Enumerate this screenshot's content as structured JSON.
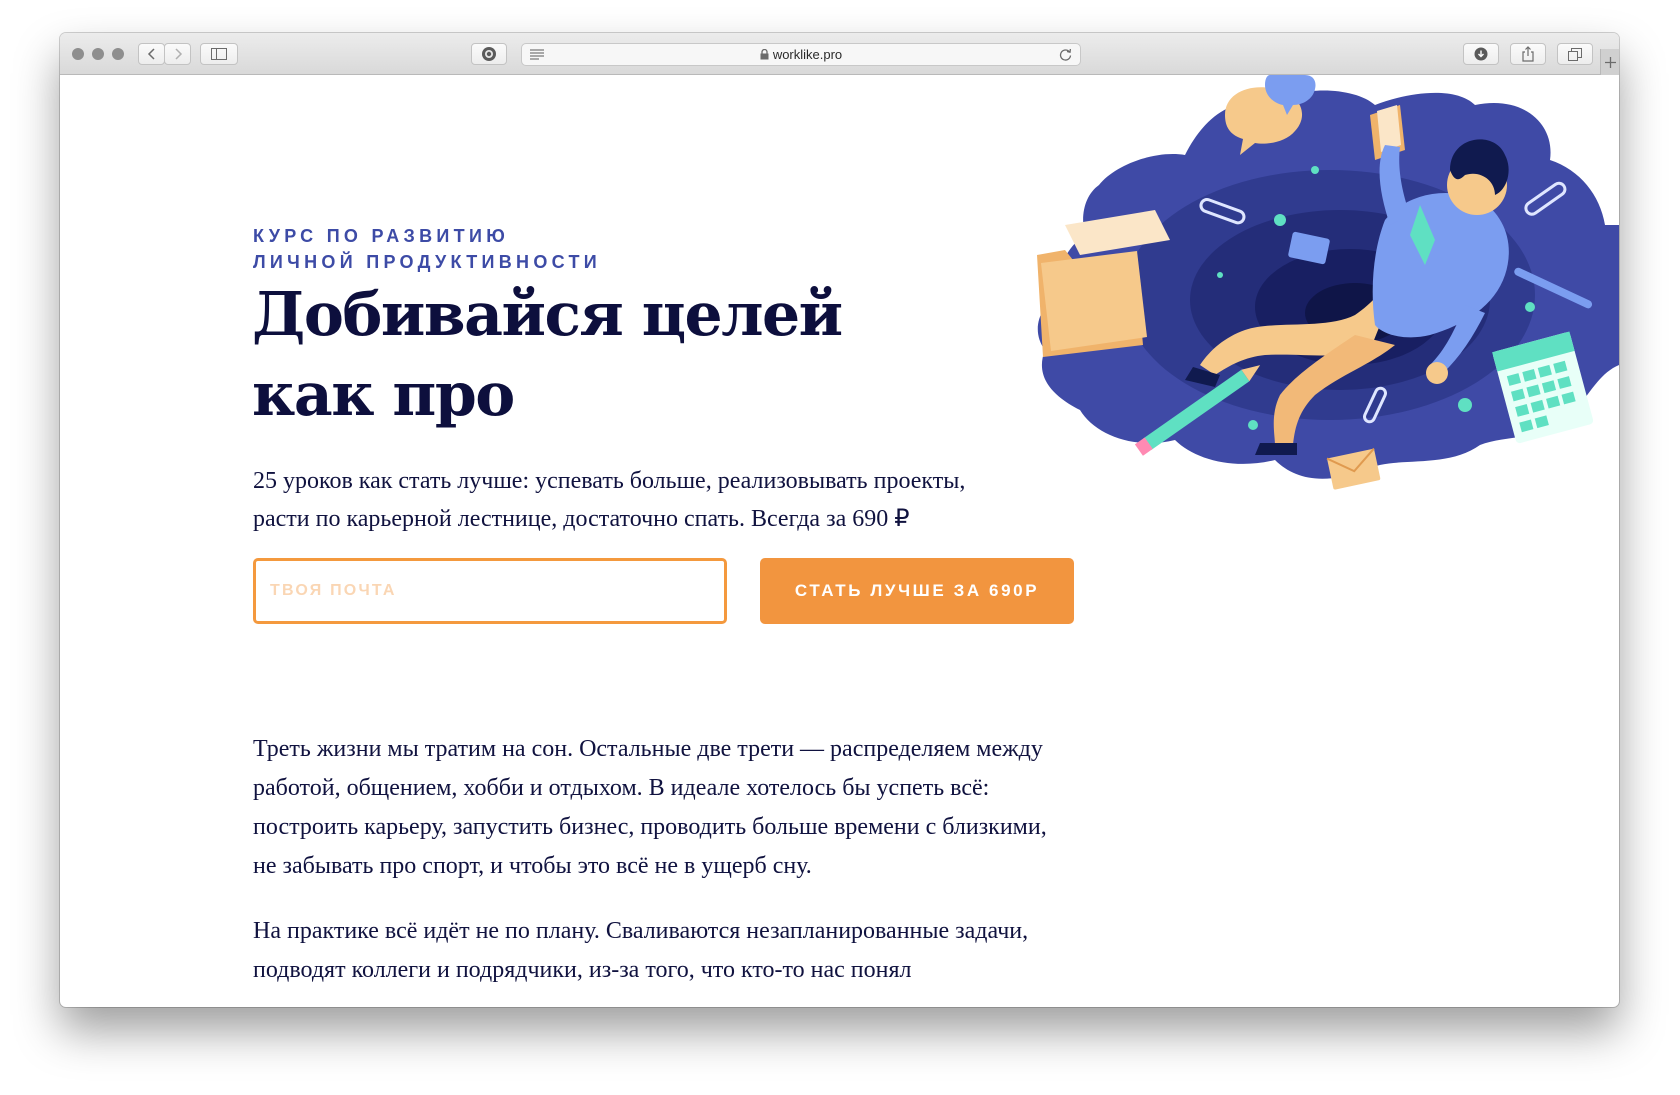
{
  "browser": {
    "url": "worklike.pro"
  },
  "hero": {
    "eyebrow_line1": "КУРС ПО РАЗВИТИЮ",
    "eyebrow_line2": "ЛИЧНОЙ ПРОДУКТИВНОСТИ",
    "title_line1": "Добивайся целей",
    "title_line2": "как про",
    "lead_line1": "25 уроков как стать лучше: успевать больше, реализовывать проекты,",
    "lead_line2": "расти по карьерной лестнице, достаточно спать. Всегда за 690 ₽",
    "email_placeholder": "ТВОЯ ПОЧТА",
    "cta_label": "СТАТЬ ЛУЧШЕ ЗА 690Р"
  },
  "article": {
    "paragraph1": "Треть жизни мы тратим на сон. Остальные две трети — распределяем между работой, общением, хобби и отдыхом. В идеале хотелось бы успеть всё: построить карьеру, запустить бизнес, проводить больше времени с близкими, не забывать про спорт, и чтобы это всё не в ущерб сну.",
    "paragraph2": "На практике всё идёт не по плану. Сваливаются незапланированные задачи, подводят коллеги и подрядчики, из-за того, что кто-то нас понял"
  },
  "colors": {
    "accent": "#f2953f",
    "heading": "#0d0f3d",
    "eyebrow": "#3d4ba6",
    "illustration_blue": "#3f4aa6"
  }
}
